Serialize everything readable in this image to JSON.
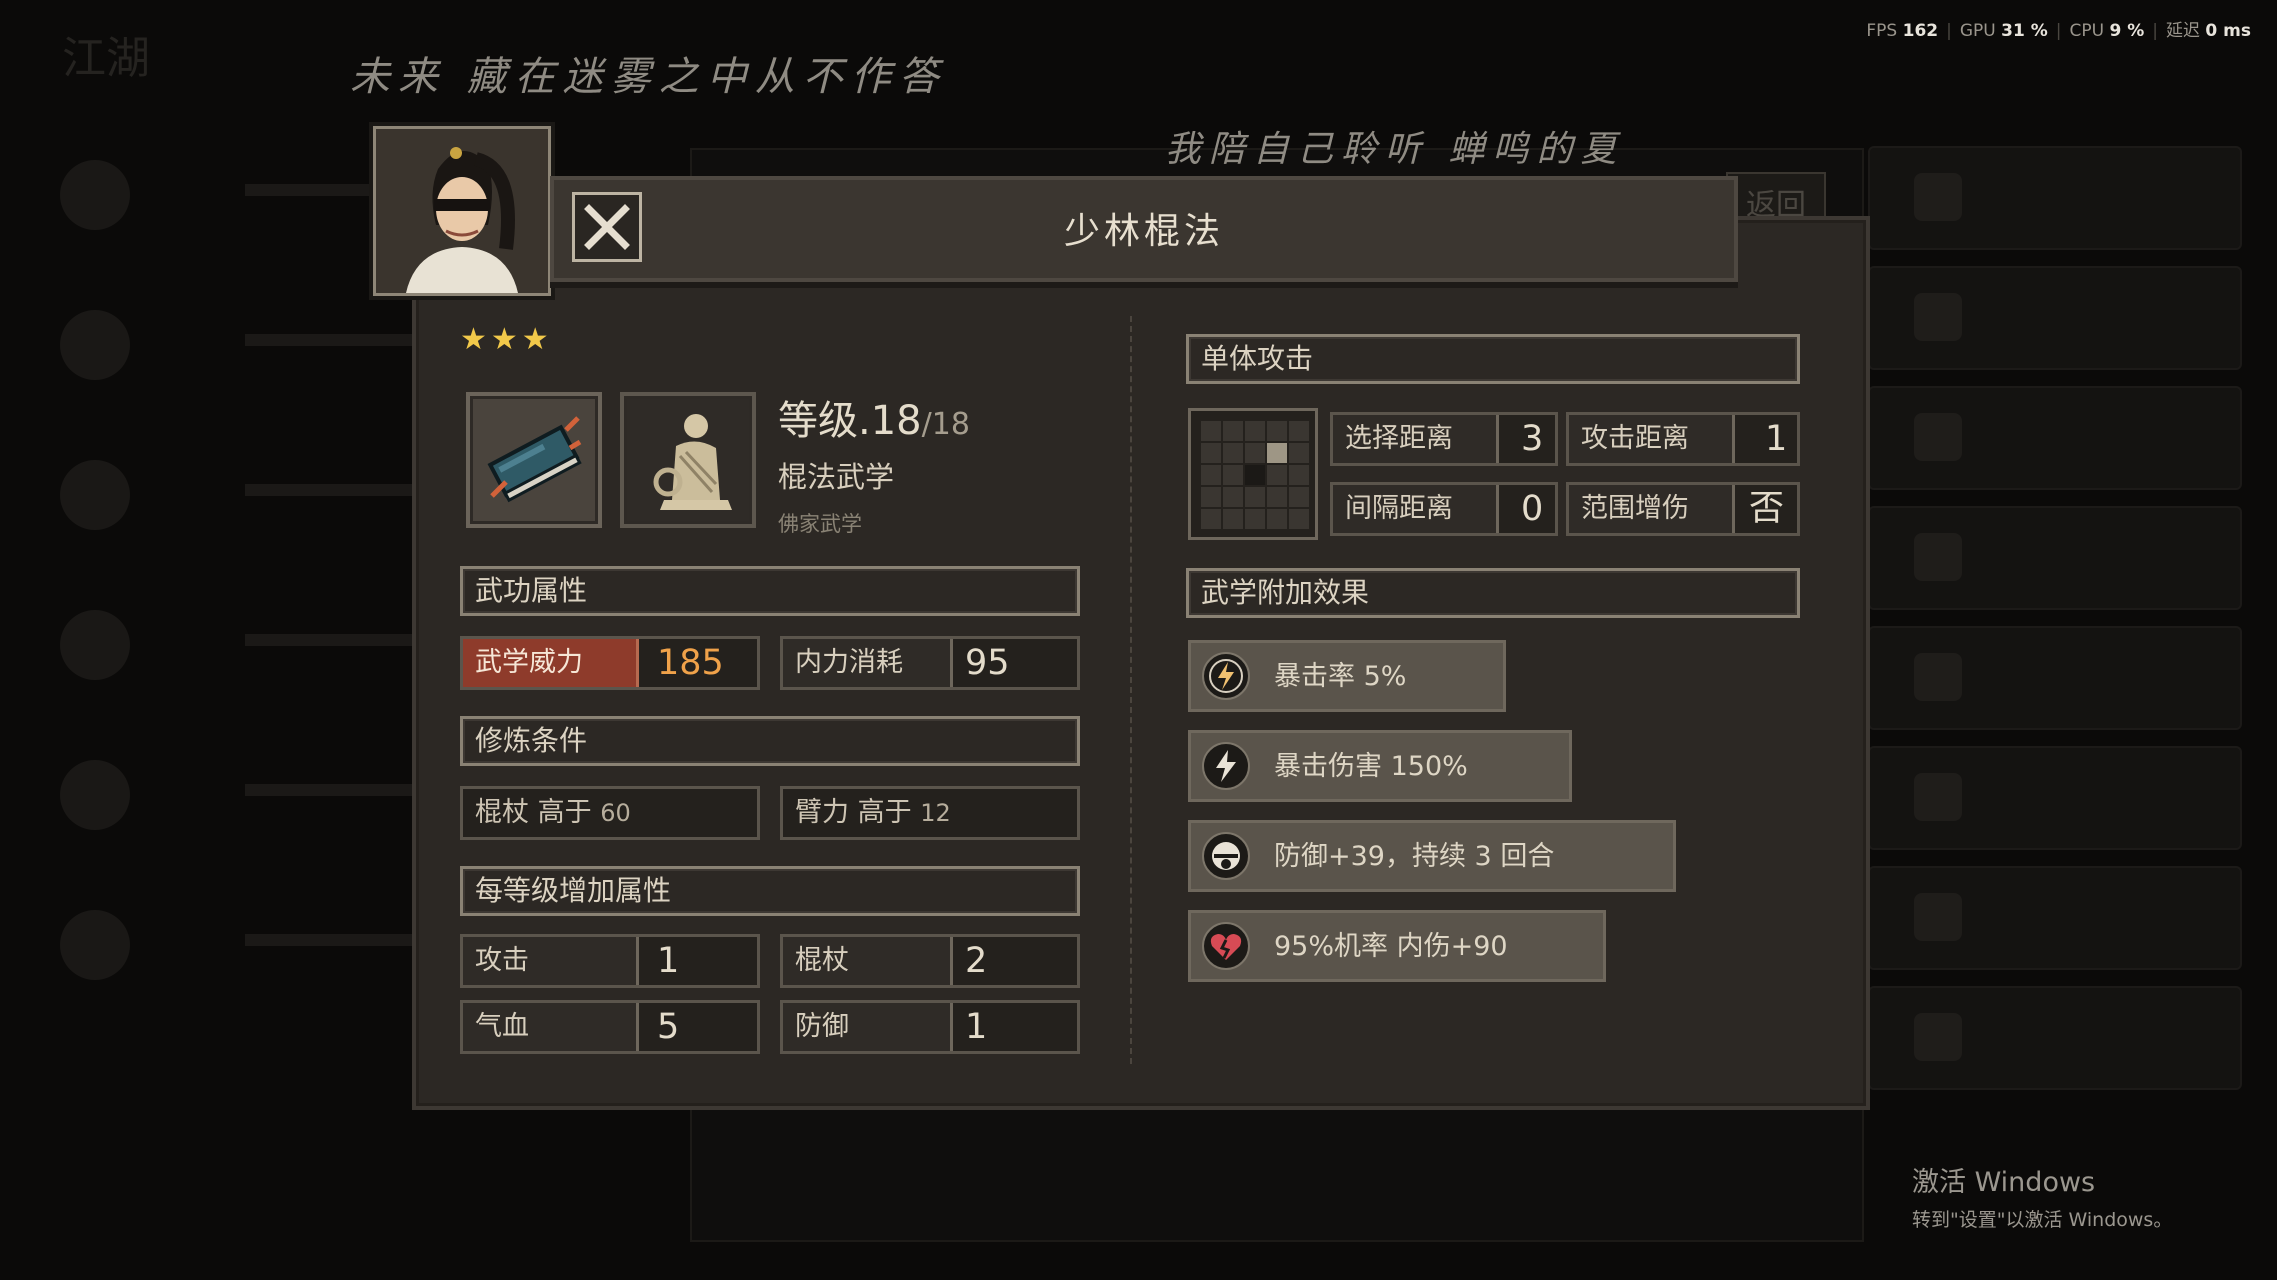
{
  "perf": {
    "fps_label": "FPS",
    "fps": "162",
    "gpu_label": "GPU",
    "gpu": "31 %",
    "cpu_label": "CPU",
    "cpu": "9 %",
    "latency_label": "延迟",
    "latency": "0 ms"
  },
  "lyrics": {
    "line1": "未来 藏在迷雾之中从不作答",
    "line2": "我陪自己聆听 蝉鸣的夏"
  },
  "dialog": {
    "title": "少林棍法",
    "stars": "★★★",
    "level_label": "等级.",
    "level": "18",
    "level_max": "/18",
    "type": "棍法武学",
    "subtype": "佛家武学"
  },
  "attributes": {
    "header": "武功属性",
    "power_label": "武学威力",
    "power": "185",
    "mp_label": "内力消耗",
    "mp": "95"
  },
  "training": {
    "header": "修炼条件",
    "req1_label": "棍杖 高于",
    "req1_value": "60",
    "req2_label": "臂力 高于",
    "req2_value": "12"
  },
  "per_level": {
    "header": "每等级增加属性",
    "items": [
      {
        "label": "攻击",
        "value": "1"
      },
      {
        "label": "棍杖",
        "value": "2"
      },
      {
        "label": "气血",
        "value": "5"
      },
      {
        "label": "防御",
        "value": "1"
      }
    ]
  },
  "attack": {
    "header": "单体攻击",
    "select_label": "选择距离",
    "select_value": "3",
    "attack_label": "攻击距离",
    "attack_value": "1",
    "gap_label": "间隔距离",
    "gap_value": "0",
    "aoe_label": "范围增伤",
    "aoe_value": "否"
  },
  "effects": {
    "header": "武学附加效果",
    "items": [
      {
        "icon": "lightning-icon",
        "text": "暴击率 5%"
      },
      {
        "icon": "lightning-icon",
        "text": "暴击伤害 150%"
      },
      {
        "icon": "shield-icon",
        "text": "防御+39，持续 3 回合"
      },
      {
        "icon": "broken-heart-icon",
        "text": "95%机率 内伤+90"
      }
    ]
  },
  "background": {
    "back_button": "返回"
  },
  "windows": {
    "line1": "激活 Windows",
    "line2": "转到\"设置\"以激活 Windows。"
  },
  "colors": {
    "panel": "#2c2824",
    "power_label_bg": "#8e3b2b",
    "power_value": "#f0a24a",
    "stars": "#f2c94a"
  }
}
